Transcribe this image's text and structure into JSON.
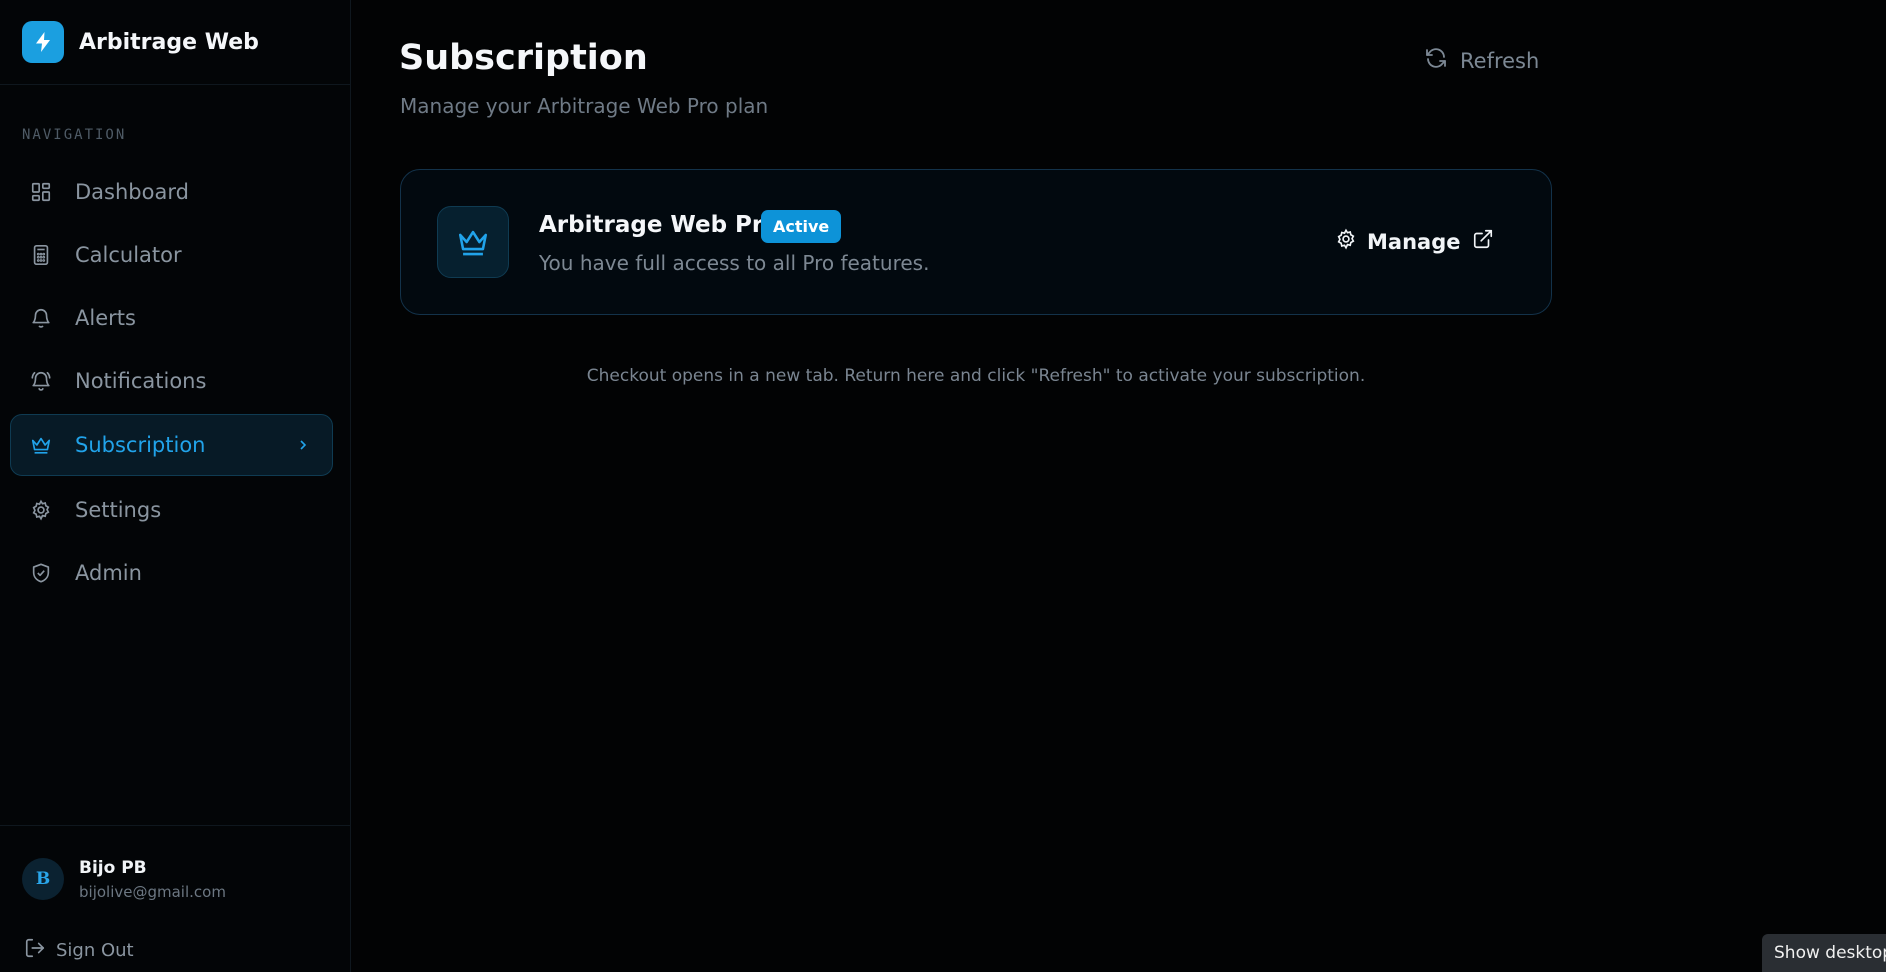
{
  "app": {
    "name": "Arbitrage Web"
  },
  "sidebar": {
    "heading": "NAVIGATION",
    "items": [
      {
        "label": "Dashboard",
        "icon": "dashboard-grid-icon",
        "active": false
      },
      {
        "label": "Calculator",
        "icon": "calculator-icon",
        "active": false
      },
      {
        "label": "Alerts",
        "icon": "bell-icon",
        "active": false
      },
      {
        "label": "Notifications",
        "icon": "bell-ring-icon",
        "active": false
      },
      {
        "label": "Subscription",
        "icon": "crown-icon",
        "active": true
      },
      {
        "label": "Settings",
        "icon": "gear-icon",
        "active": false
      },
      {
        "label": "Admin",
        "icon": "shield-check-icon",
        "active": false
      }
    ]
  },
  "user": {
    "initial": "B",
    "name": "Bijo PB",
    "email": "bijolive@gmail.com",
    "sign_out_label": "Sign Out"
  },
  "page": {
    "title": "Subscription",
    "subtitle": "Manage your Arbitrage Web Pro plan",
    "refresh_label": "Refresh"
  },
  "plan": {
    "name": "Arbitrage Web Pro",
    "status": "Active",
    "description": "You have full access to all Pro features.",
    "manage_label": "Manage"
  },
  "note": "Checkout opens in a new tab. Return here and click \"Refresh\" to activate your subscription.",
  "taskbar": {
    "show_desktop_label": "Show desktop"
  },
  "colors": {
    "accent": "#1b9fe0",
    "background": "#020304",
    "active_text": "#21a3ea"
  }
}
